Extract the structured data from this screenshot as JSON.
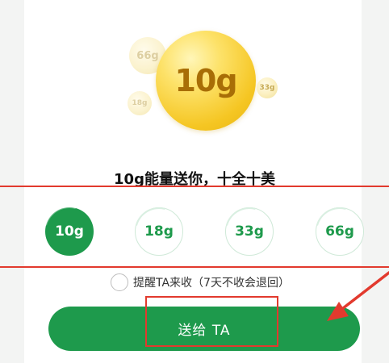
{
  "energy_balls": {
    "main": "10g",
    "small_a": "66g",
    "small_b": "18g",
    "small_c": "33g"
  },
  "headline": "10g能量送你，十全十美",
  "options": [
    {
      "label": "10g",
      "selected": true
    },
    {
      "label": "18g",
      "selected": false
    },
    {
      "label": "33g",
      "selected": false
    },
    {
      "label": "66g",
      "selected": false
    }
  ],
  "remind": {
    "label": "提醒TA来收（7天不收会退回）",
    "checked": false
  },
  "send_button": {
    "label": "送给 TA"
  },
  "colors": {
    "accent_green": "#1e9a4c",
    "annotation_red": "#e23a2e",
    "gold": "#f5c623"
  }
}
